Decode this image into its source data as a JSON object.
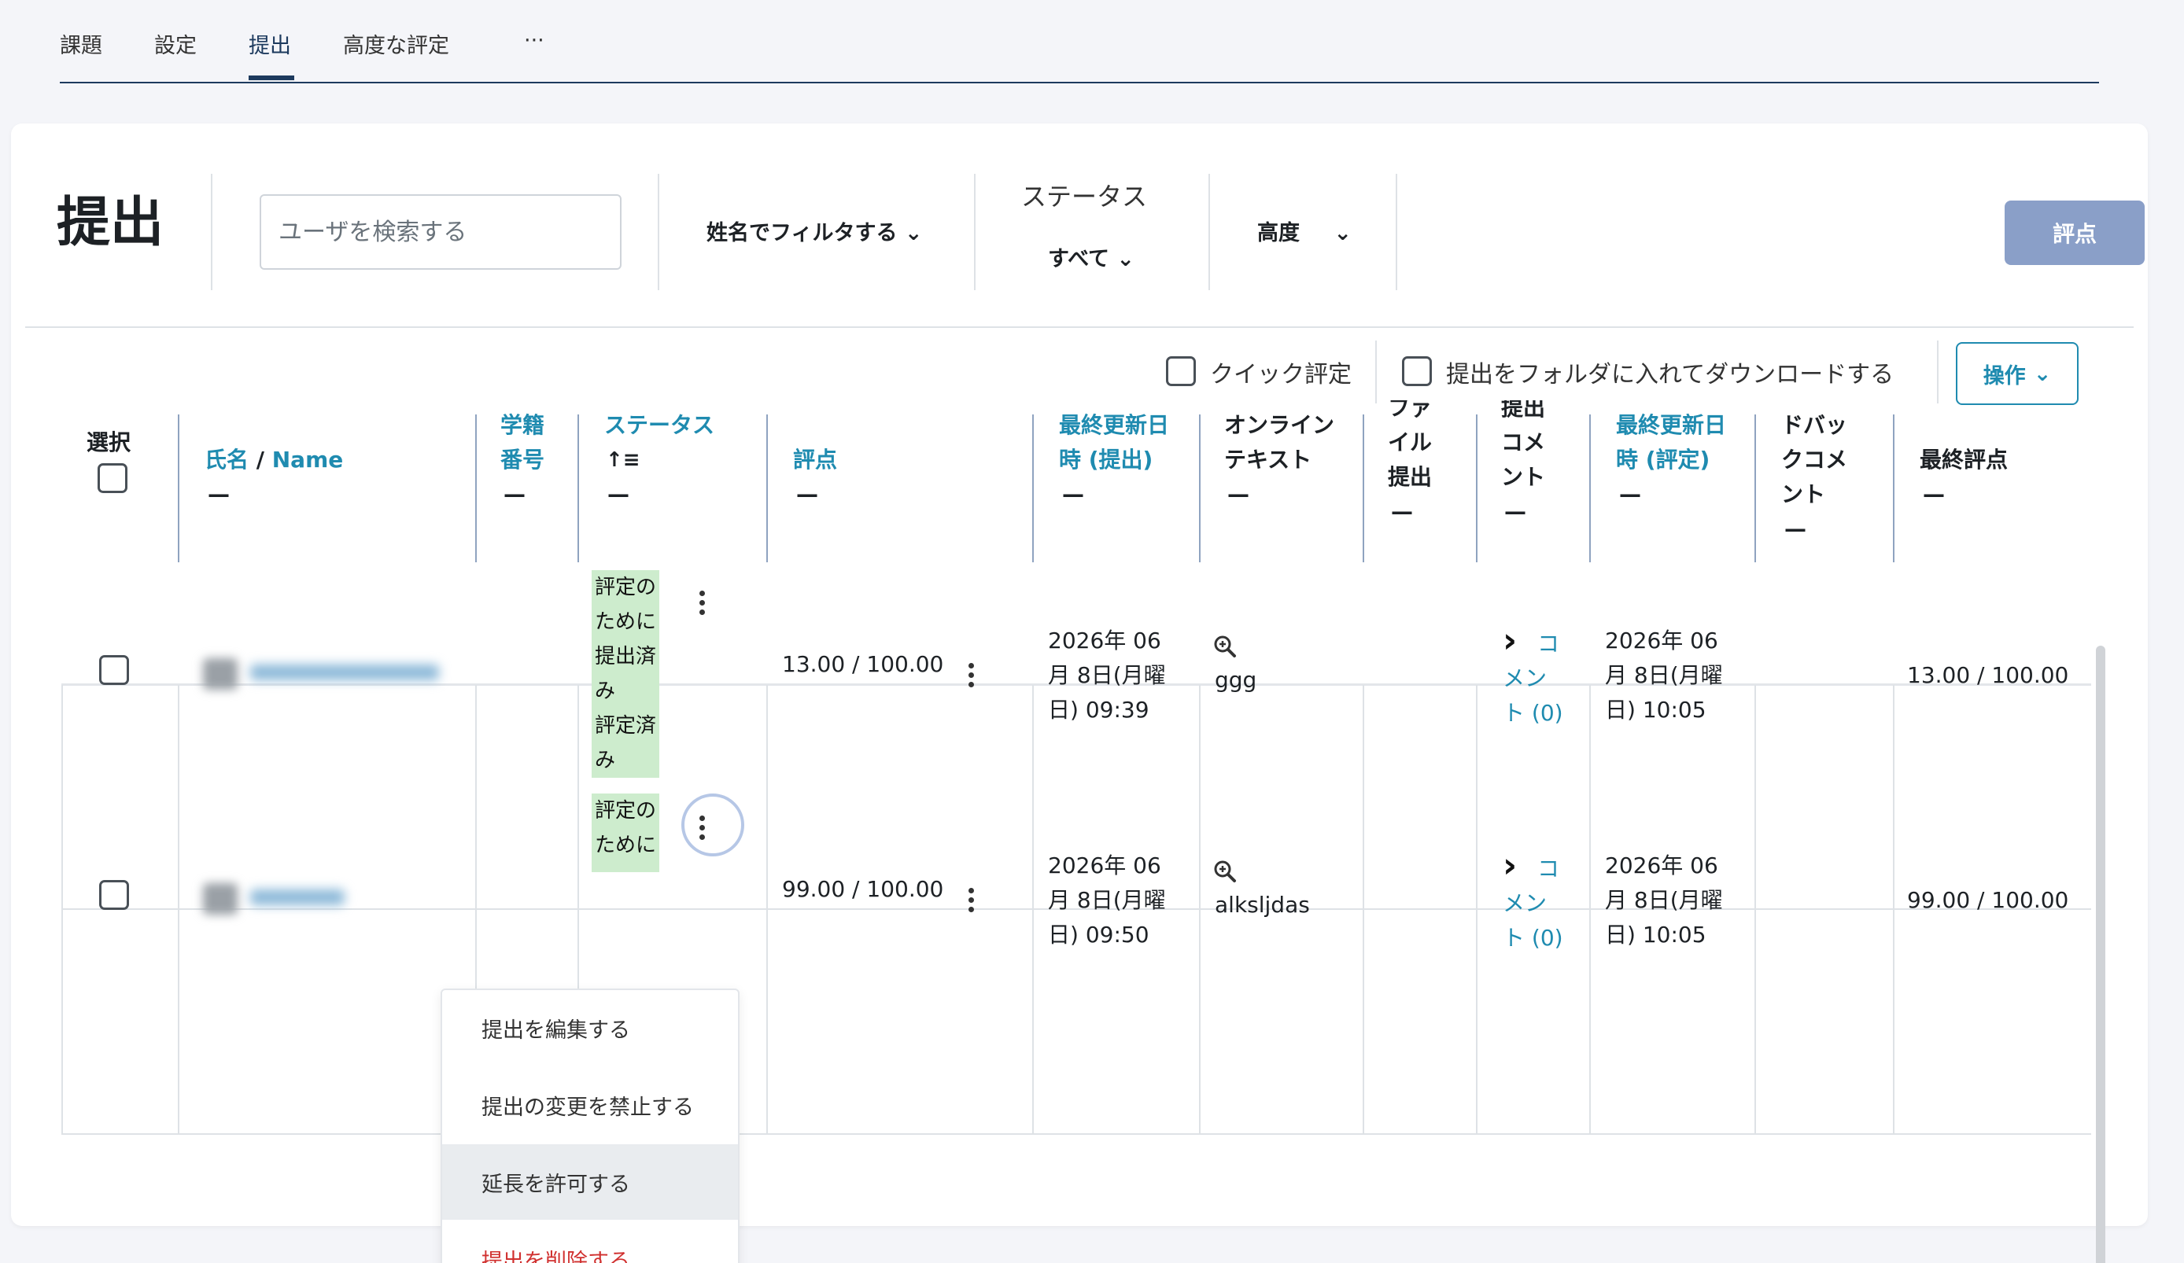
{
  "tabs": [
    {
      "label": "課題"
    },
    {
      "label": "設定"
    },
    {
      "label": "提出"
    },
    {
      "label": "高度な評定"
    },
    {
      "label": "···"
    }
  ],
  "page": {
    "title": "提出",
    "search_placeholder": "ユーザを検索する",
    "name_filter": "姓名でフィルタする ⌄",
    "status_label": "ステータス",
    "status_value": "すべて ⌄",
    "advanced": "高度",
    "advanced_chevron": "⌄",
    "grade_button": "評点"
  },
  "options": {
    "quick_grade": "クイック評定",
    "download_folders": "提出をフォルダに入れてダウンロードする",
    "actions": "操作",
    "actions_chevron": "⌄"
  },
  "columns": {
    "select": "選択",
    "name_a": "氏名",
    "name_slash": " / ",
    "name_b": "Name",
    "idnumber_1": "学籍",
    "idnumber_2": "番号",
    "status": "ステータス",
    "sort_icon": "↑≡",
    "grade": "評点",
    "modified_sub_1": "最終更新日",
    "modified_sub_2": "時 (提出)",
    "online_1": "オンライン",
    "online_2": "テキスト",
    "file_0": "ファ",
    "file_1": "イル",
    "file_2": "提出",
    "comments_0": "提出",
    "comments_1": "コメ",
    "comments_2": "ント",
    "modified_grade_1": "最終更新日",
    "modified_grade_2": "時 (評定)",
    "feedback_1": "ドバッ",
    "feedback_2": "クコメ",
    "feedback_3": "ント",
    "final_grade": "最終評点",
    "dash": "—"
  },
  "rows": [
    {
      "status_1": "評定の",
      "status_2": "ために",
      "status_3": "提出済",
      "status_4": "み",
      "status_5": "評定済",
      "status_6": "み",
      "grade": "13.00 / 100.00",
      "modified_1": "2026年 06",
      "modified_2": "月 8日(月曜",
      "modified_3": "日) 09:39",
      "online_text": "ggg",
      "comment_1": "コ",
      "comment_2": "メン",
      "comment_3": "ト (0)",
      "graded_1": "2026年 06",
      "graded_2": "月 8日(月曜",
      "graded_3": "日) 10:05",
      "final": "13.00 / 100.00"
    },
    {
      "status_1": "評定の",
      "status_2": "ために",
      "grade": "99.00 / 100.00",
      "modified_1": "2026年 06",
      "modified_2": "月 8日(月曜",
      "modified_3": "日) 09:50",
      "online_text": "alksljdas",
      "comment_1": "コ",
      "comment_2": "メン",
      "comment_3": "ト (0)",
      "graded_1": "2026年 06",
      "graded_2": "月 8日(月曜",
      "graded_3": "日) 10:05",
      "final": "99.00 / 100.00"
    }
  ],
  "menu": {
    "edit": "提出を編集する",
    "lock": "提出の変更を禁止する",
    "extend": "延長を許可する",
    "delete": "提出を削除する"
  },
  "colors": {
    "accent": "#1f8bb0",
    "nav": "#1d3a5e",
    "grade_button": "#8a9fc8",
    "status_bg": "#cdeccd",
    "danger": "#d0302f"
  }
}
